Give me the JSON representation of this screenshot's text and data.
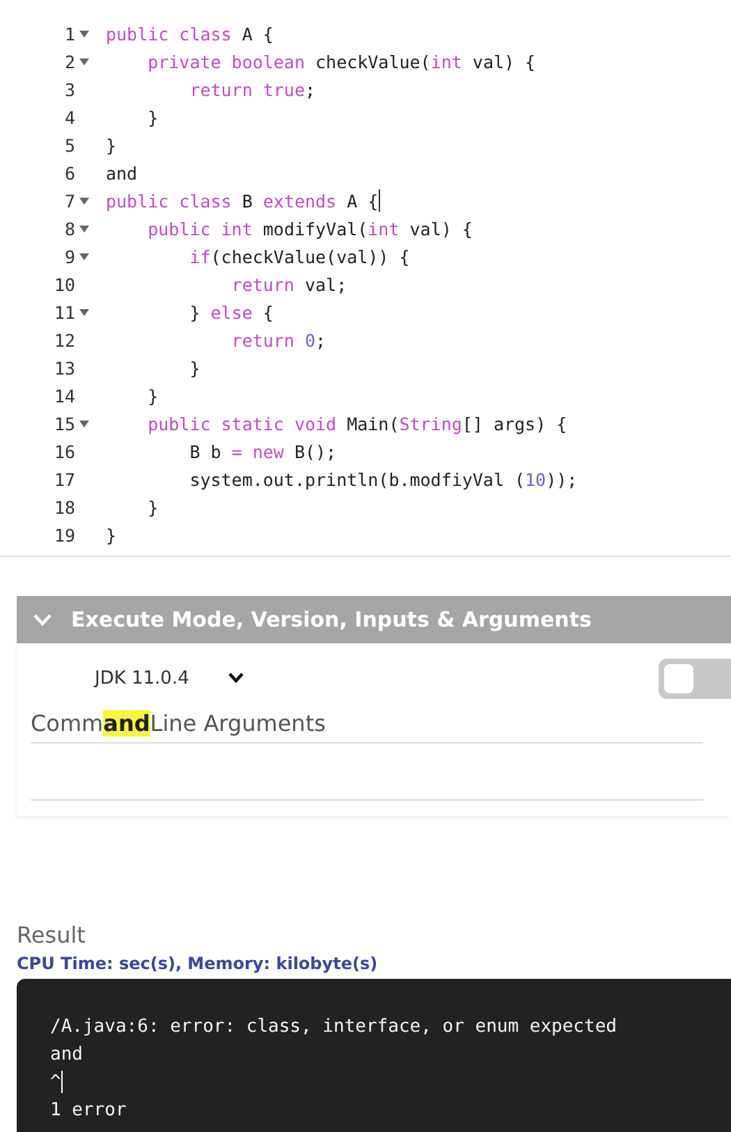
{
  "editor": {
    "lines": [
      {
        "number": "1",
        "foldable": true,
        "cursor": false,
        "tokens": [
          {
            "kind": "kw",
            "text": "public class "
          },
          {
            "kind": "plain",
            "text": "A {"
          }
        ]
      },
      {
        "number": "2",
        "foldable": true,
        "cursor": false,
        "tokens": [
          {
            "kind": "kw",
            "text": "    private boolean "
          },
          {
            "kind": "plain",
            "text": "checkValue("
          },
          {
            "kind": "kw",
            "text": "int "
          },
          {
            "kind": "plain",
            "text": "val) {"
          }
        ]
      },
      {
        "number": "3",
        "foldable": false,
        "cursor": false,
        "tokens": [
          {
            "kind": "kw",
            "text": "        return true"
          },
          {
            "kind": "plain",
            "text": ";"
          }
        ]
      },
      {
        "number": "4",
        "foldable": false,
        "cursor": false,
        "tokens": [
          {
            "kind": "plain",
            "text": "    }"
          }
        ]
      },
      {
        "number": "5",
        "foldable": false,
        "cursor": false,
        "tokens": [
          {
            "kind": "plain",
            "text": "}"
          }
        ]
      },
      {
        "number": "6",
        "foldable": false,
        "cursor": false,
        "tokens": [
          {
            "kind": "plain",
            "text": "and"
          }
        ]
      },
      {
        "number": "7",
        "foldable": true,
        "cursor": true,
        "tokens": [
          {
            "kind": "kw",
            "text": "public class "
          },
          {
            "kind": "plain",
            "text": "B "
          },
          {
            "kind": "kw",
            "text": "extends "
          },
          {
            "kind": "plain",
            "text": "A {"
          }
        ]
      },
      {
        "number": "8",
        "foldable": true,
        "cursor": false,
        "tokens": [
          {
            "kind": "kw",
            "text": "    public int "
          },
          {
            "kind": "plain",
            "text": "modifyVal("
          },
          {
            "kind": "kw",
            "text": "int "
          },
          {
            "kind": "plain",
            "text": "val) {"
          }
        ]
      },
      {
        "number": "9",
        "foldable": true,
        "cursor": false,
        "tokens": [
          {
            "kind": "kw",
            "text": "        if"
          },
          {
            "kind": "plain",
            "text": "(checkValue(val)) {"
          }
        ]
      },
      {
        "number": "10",
        "foldable": false,
        "cursor": false,
        "tokens": [
          {
            "kind": "kw",
            "text": "            return "
          },
          {
            "kind": "plain",
            "text": "val;"
          }
        ]
      },
      {
        "number": "11",
        "foldable": true,
        "cursor": false,
        "tokens": [
          {
            "kind": "plain",
            "text": "        } "
          },
          {
            "kind": "kw",
            "text": "else "
          },
          {
            "kind": "plain",
            "text": "{"
          }
        ]
      },
      {
        "number": "12",
        "foldable": false,
        "cursor": false,
        "tokens": [
          {
            "kind": "kw",
            "text": "            return "
          },
          {
            "kind": "num",
            "text": "0"
          },
          {
            "kind": "plain",
            "text": ";"
          }
        ]
      },
      {
        "number": "13",
        "foldable": false,
        "cursor": false,
        "tokens": [
          {
            "kind": "plain",
            "text": "        }"
          }
        ]
      },
      {
        "number": "14",
        "foldable": false,
        "cursor": false,
        "tokens": [
          {
            "kind": "plain",
            "text": "    }"
          }
        ]
      },
      {
        "number": "15",
        "foldable": true,
        "cursor": false,
        "tokens": [
          {
            "kind": "kw",
            "text": "    public static void "
          },
          {
            "kind": "plain",
            "text": "Main("
          },
          {
            "kind": "kw",
            "text": "String"
          },
          {
            "kind": "plain",
            "text": "[] args) {"
          }
        ]
      },
      {
        "number": "16",
        "foldable": false,
        "cursor": false,
        "tokens": [
          {
            "kind": "plain",
            "text": "        B b "
          },
          {
            "kind": "kw",
            "text": "= new "
          },
          {
            "kind": "plain",
            "text": "B();"
          }
        ]
      },
      {
        "number": "17",
        "foldable": false,
        "cursor": false,
        "tokens": [
          {
            "kind": "plain",
            "text": "        system.out.println(b.modfiyVal ("
          },
          {
            "kind": "num",
            "text": "10"
          },
          {
            "kind": "plain",
            "text": "));"
          }
        ]
      },
      {
        "number": "18",
        "foldable": false,
        "cursor": false,
        "tokens": [
          {
            "kind": "plain",
            "text": "    }"
          }
        ]
      },
      {
        "number": "19",
        "foldable": false,
        "cursor": false,
        "tokens": [
          {
            "kind": "plain",
            "text": "}"
          }
        ]
      }
    ]
  },
  "execute_panel": {
    "title": "Execute Mode, Version, Inputs & Arguments",
    "expanded": true,
    "version": "JDK 11.0.4",
    "toggle": {
      "checked": false
    },
    "arguments_label": [
      {
        "text": "Comm",
        "highlighted": false
      },
      {
        "text": "and",
        "highlighted": true
      },
      {
        "text": "Line Arguments",
        "highlighted": false
      }
    ]
  },
  "result": {
    "title": "Result",
    "stats": "CPU Time: sec(s), Memory: kilobyte(s)",
    "output": [
      {
        "text": "/A.java:6: error: class, interface, or enum expected",
        "cursor": false
      },
      {
        "text": "and",
        "cursor": false
      },
      {
        "text": "^",
        "cursor": true
      },
      {
        "text": "1 error",
        "cursor": false
      }
    ]
  }
}
